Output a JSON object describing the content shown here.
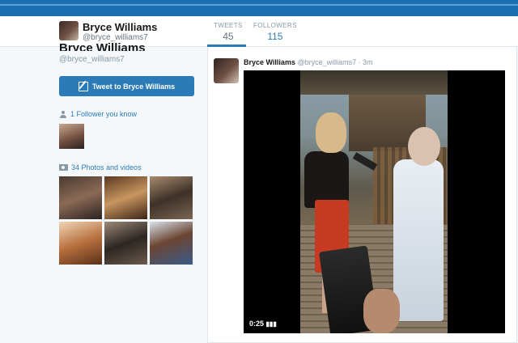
{
  "navbar": {
    "name": "Bryce Williams",
    "handle": "@bryce_williams7",
    "stats": [
      {
        "label": "TWEETS",
        "value": "45"
      },
      {
        "label": "FOLLOWERS",
        "value": "115"
      }
    ]
  },
  "profile": {
    "name": "Bryce Williams",
    "handle": "@bryce_williams7",
    "tweet_to_button": "Tweet to Bryce Williams",
    "followers_you_know": "1 Follower you know",
    "photos_videos": "34 Photos and videos"
  },
  "tweet": {
    "name": "Bryce Williams",
    "handle": "@bryce_williams7",
    "separator": "·",
    "time": "3m",
    "video_timestamp": "0:25"
  },
  "colors": {
    "accent": "#2b7bb9",
    "topbar": "#1b6fb0"
  }
}
